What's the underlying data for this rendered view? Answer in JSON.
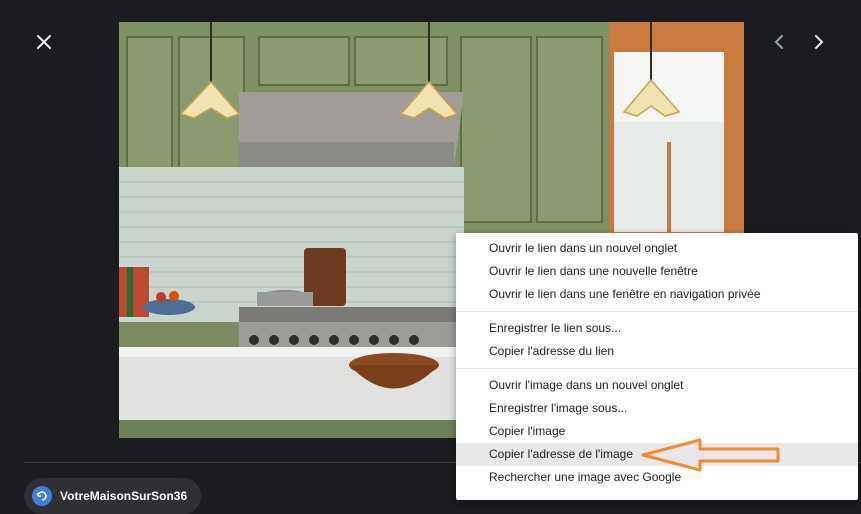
{
  "viewer": {
    "close_icon": "close-icon",
    "prev_icon": "chevron-left-icon",
    "next_icon": "chevron-right-icon"
  },
  "image": {
    "subject": "kitchen-photo"
  },
  "source": {
    "name": "VotreMaisonSurSon36",
    "icon": "website-logo-icon"
  },
  "context_menu": {
    "groups": [
      [
        "Ouvrir le lien dans un nouvel onglet",
        "Ouvrir le lien dans une nouvelle fenêtre",
        "Ouvrir le lien dans une fenêtre en navigation privée"
      ],
      [
        "Enregistrer le lien sous...",
        "Copier l'adresse du lien"
      ],
      [
        "Ouvrir l'image dans un nouvel onglet",
        "Enregistrer l'image sous...",
        "Copier l'image",
        "Copier l'adresse de l'image",
        "Rechercher une image avec Google"
      ]
    ],
    "highlighted": "Copier l'adresse de l'image"
  },
  "annotation": {
    "arrow_color": "#f28a2e"
  }
}
